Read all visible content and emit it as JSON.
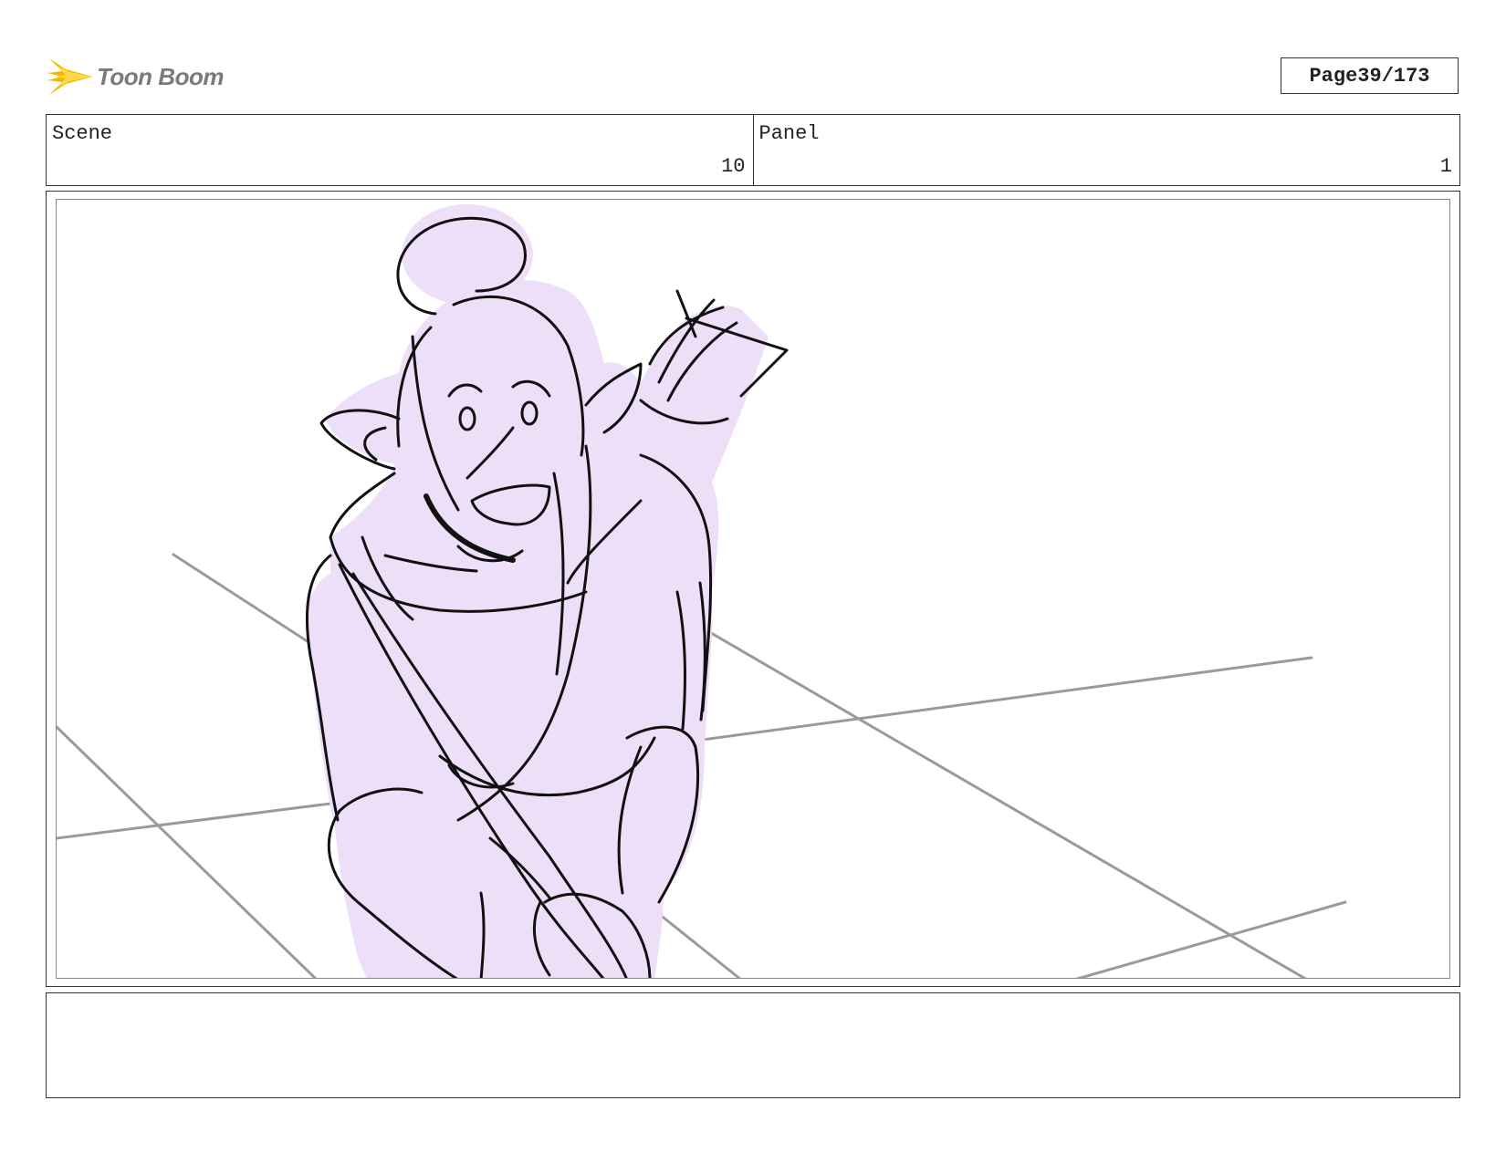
{
  "header": {
    "logo_text": "Toon Boom",
    "logo_icon": "starburst-logo-icon",
    "page_label": "Page",
    "page_number": "39/173"
  },
  "info": {
    "scene_label": "Scene",
    "scene_value": "10",
    "panel_label": "Panel",
    "panel_value": "1"
  },
  "panel": {
    "fill_color": "#eedff8",
    "line_color": "#111111",
    "guide_color": "#9a9a9a"
  },
  "notes": {
    "text": ""
  }
}
